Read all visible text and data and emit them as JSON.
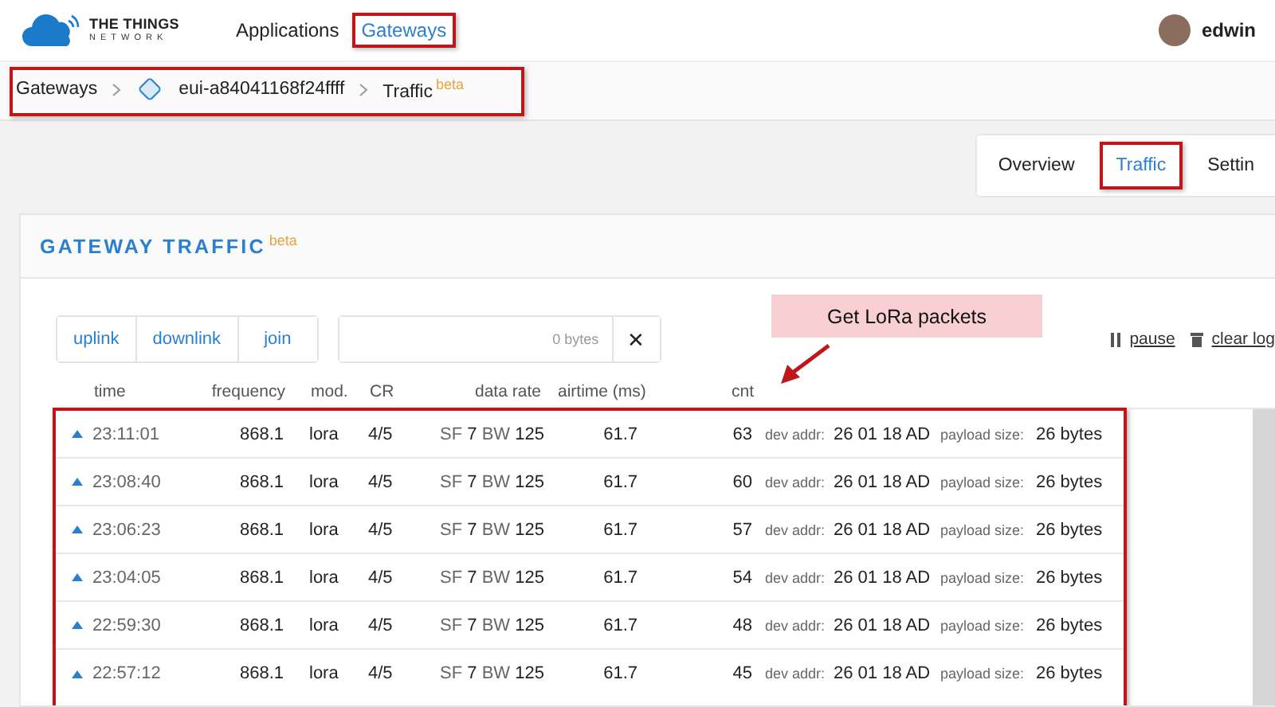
{
  "header": {
    "brand": {
      "line1": "THE THINGS",
      "line2": "NETWORK"
    },
    "nav": [
      {
        "label": "Applications",
        "selected": false,
        "highlighted": false
      },
      {
        "label": "Gateways",
        "selected": true,
        "highlighted": true
      }
    ],
    "user": "edwin"
  },
  "breadcrumb": {
    "items": [
      "Gateways",
      "eui-a84041168f24ffff",
      "Traffic"
    ],
    "badge": "beta"
  },
  "tabs": [
    {
      "label": "Overview",
      "selected": false
    },
    {
      "label": "Traffic",
      "selected": true
    },
    {
      "label": "Settin",
      "selected": false
    }
  ],
  "card": {
    "title": "GATEWAY TRAFFIC",
    "badge": "beta"
  },
  "filters": [
    {
      "label": "uplink"
    },
    {
      "label": "downlink"
    },
    {
      "label": "join"
    }
  ],
  "payload_filter": {
    "placeholder": "0 bytes",
    "clear": "✕"
  },
  "actions": [
    {
      "kind": "pause",
      "label": "pause"
    },
    {
      "kind": "clear",
      "label": "clear log"
    }
  ],
  "callout": "Get LoRa packets",
  "columns": [
    "time",
    "frequency",
    "mod.",
    "CR",
    "data rate",
    "airtime (ms)",
    "cnt"
  ],
  "rows": [
    {
      "time": "23:11:01",
      "frequency": "868.1",
      "mod": "lora",
      "cr": "4/5",
      "sf_label": "SF",
      "sf": "7",
      "bw_label": "BW",
      "bw": "125",
      "airtime": "61.7",
      "cnt": "63",
      "dev_addr_label": "dev addr:",
      "dev_addr": "26 01 18 AD",
      "payload_label": "payload size:",
      "payload": "26 bytes"
    },
    {
      "time": "23:08:40",
      "frequency": "868.1",
      "mod": "lora",
      "cr": "4/5",
      "sf_label": "SF",
      "sf": "7",
      "bw_label": "BW",
      "bw": "125",
      "airtime": "61.7",
      "cnt": "60",
      "dev_addr_label": "dev addr:",
      "dev_addr": "26 01 18 AD",
      "payload_label": "payload size:",
      "payload": "26 bytes"
    },
    {
      "time": "23:06:23",
      "frequency": "868.1",
      "mod": "lora",
      "cr": "4/5",
      "sf_label": "SF",
      "sf": "7",
      "bw_label": "BW",
      "bw": "125",
      "airtime": "61.7",
      "cnt": "57",
      "dev_addr_label": "dev addr:",
      "dev_addr": "26 01 18 AD",
      "payload_label": "payload size:",
      "payload": "26 bytes"
    },
    {
      "time": "23:04:05",
      "frequency": "868.1",
      "mod": "lora",
      "cr": "4/5",
      "sf_label": "SF",
      "sf": "7",
      "bw_label": "BW",
      "bw": "125",
      "airtime": "61.7",
      "cnt": "54",
      "dev_addr_label": "dev addr:",
      "dev_addr": "26 01 18 AD",
      "payload_label": "payload size:",
      "payload": "26 bytes"
    },
    {
      "time": "22:59:30",
      "frequency": "868.1",
      "mod": "lora",
      "cr": "4/5",
      "sf_label": "SF",
      "sf": "7",
      "bw_label": "BW",
      "bw": "125",
      "airtime": "61.7",
      "cnt": "48",
      "dev_addr_label": "dev addr:",
      "dev_addr": "26 01 18 AD",
      "payload_label": "payload size:",
      "payload": "26 bytes"
    },
    {
      "time": "22:57:12",
      "frequency": "868.1",
      "mod": "lora",
      "cr": "4/5",
      "sf_label": "SF",
      "sf": "7",
      "bw_label": "BW",
      "bw": "125",
      "airtime": "61.7",
      "cnt": "45",
      "dev_addr_label": "dev addr:",
      "dev_addr": "26 01 18 AD",
      "payload_label": "payload size:",
      "payload": "26 bytes"
    }
  ]
}
